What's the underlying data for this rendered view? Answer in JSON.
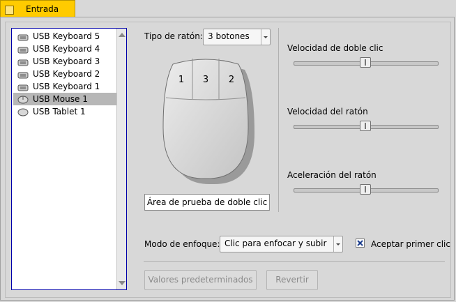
{
  "tab": {
    "label": "Entrada"
  },
  "devices": [
    {
      "label": "USB Keyboard 5",
      "icon": "keyboard-icon",
      "selected": false
    },
    {
      "label": "USB Keyboard 4",
      "icon": "keyboard-icon",
      "selected": false
    },
    {
      "label": "USB Keyboard 3",
      "icon": "keyboard-icon",
      "selected": false
    },
    {
      "label": "USB Keyboard 2",
      "icon": "keyboard-icon",
      "selected": false
    },
    {
      "label": "USB Keyboard 1",
      "icon": "keyboard-icon",
      "selected": false
    },
    {
      "label": "USB Mouse 1",
      "icon": "mouse-icon",
      "selected": true
    },
    {
      "label": "USB Tablet 1",
      "icon": "tablet-icon",
      "selected": false
    }
  ],
  "mouse_type": {
    "label": "Tipo de ratón:",
    "value": "3 botones",
    "buttons": [
      "1",
      "3",
      "2"
    ]
  },
  "double_click_test": "Área de prueba de doble clic",
  "sliders": {
    "double_click_speed": {
      "label": "Velocidad de doble clic",
      "value": 0.5
    },
    "mouse_speed": {
      "label": "Velocidad del ratón",
      "value": 0.5
    },
    "mouse_acceleration": {
      "label": "Aceleración del ratón",
      "value": 0.5
    }
  },
  "focus_mode": {
    "label": "Modo de enfoque:",
    "value": "Clic para enfocar y subir"
  },
  "accept_first_click": {
    "label": "Aceptar primer clic",
    "checked": true
  },
  "buttons": {
    "defaults": "Valores predeterminados",
    "revert": "Revertir"
  },
  "colors": {
    "tab_accent": "#ffcb00",
    "list_border": "#0000aa",
    "selection": "#b7b7b7",
    "check_mark": "#1a3c8c"
  }
}
